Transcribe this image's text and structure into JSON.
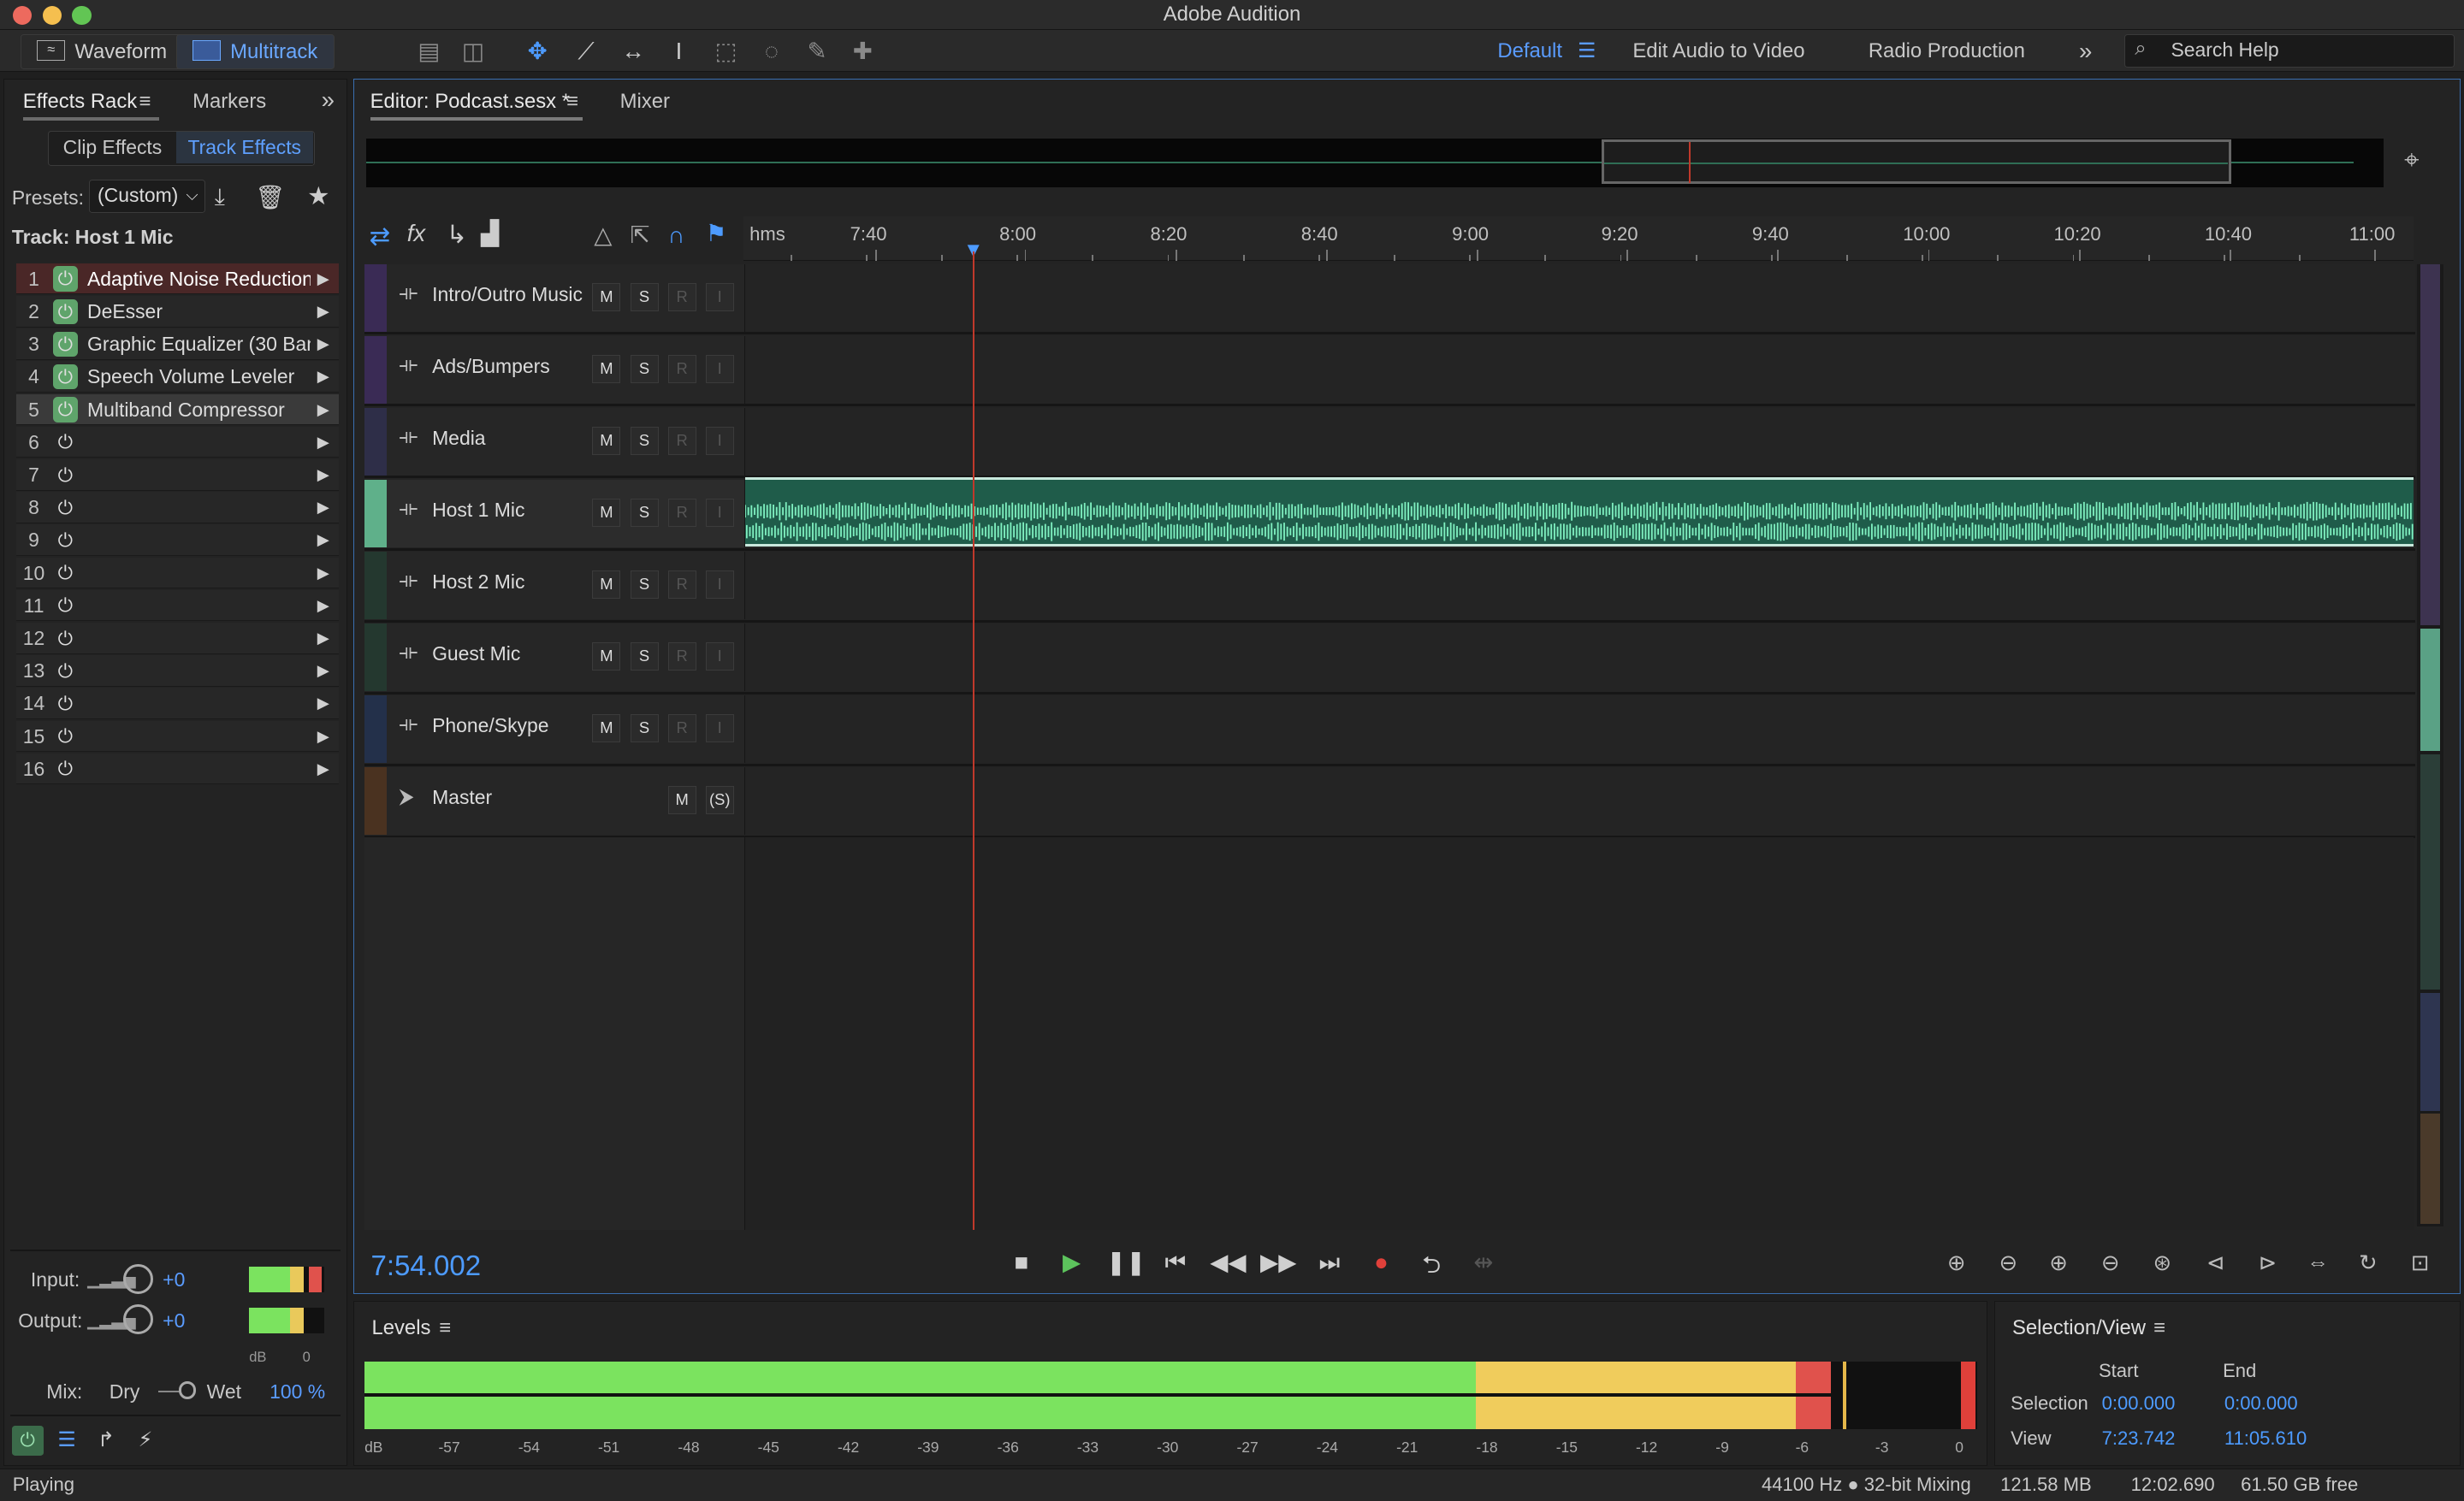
{
  "app": {
    "title": "Adobe Audition"
  },
  "toolbar": {
    "waveform": "Waveform",
    "multitrack": "Multitrack",
    "workspaces": [
      "Default",
      "Edit Audio to Video",
      "Radio Production"
    ],
    "search": "Search Help"
  },
  "left": {
    "tabs": [
      "Effects Rack",
      "Markers"
    ],
    "subtabs": [
      "Clip Effects",
      "Track Effects"
    ],
    "presets_label": "Presets:",
    "preset": "(Custom)",
    "track_label": "Track: Host 1 Mic",
    "effects": [
      {
        "n": "1",
        "name": "Adaptive Noise Reduction",
        "on": true
      },
      {
        "n": "2",
        "name": "DeEsser",
        "on": true
      },
      {
        "n": "3",
        "name": "Graphic Equalizer (30 Ban",
        "on": true
      },
      {
        "n": "4",
        "name": "Speech Volume Leveler",
        "on": true
      },
      {
        "n": "5",
        "name": "Multiband Compressor",
        "on": true
      },
      {
        "n": "6",
        "name": "",
        "on": false
      },
      {
        "n": "7",
        "name": "",
        "on": false
      },
      {
        "n": "8",
        "name": "",
        "on": false
      },
      {
        "n": "9",
        "name": "",
        "on": false
      },
      {
        "n": "10",
        "name": "",
        "on": false
      },
      {
        "n": "11",
        "name": "",
        "on": false
      },
      {
        "n": "12",
        "name": "",
        "on": false
      },
      {
        "n": "13",
        "name": "",
        "on": false
      },
      {
        "n": "14",
        "name": "",
        "on": false
      },
      {
        "n": "15",
        "name": "",
        "on": false
      },
      {
        "n": "16",
        "name": "",
        "on": false
      }
    ],
    "input_label": "Input:",
    "output_label": "Output:",
    "input_val": "+0",
    "output_val": "+0",
    "db_label": "dB",
    "zero": "0",
    "mix_label": "Mix:",
    "dry": "Dry",
    "wet": "Wet",
    "mix_pct": "100 %"
  },
  "editor": {
    "tab": "Editor: Podcast.sesx *",
    "mixer": "Mixer",
    "ruler": [
      "hms",
      "7:40",
      "8:00",
      "8:20",
      "8:40",
      "9:00",
      "9:20",
      "9:40",
      "10:00",
      "10:20",
      "10:40",
      "11:00"
    ],
    "tracks": [
      {
        "name": "Intro/Outro Music",
        "color": "#3a2b55"
      },
      {
        "name": "Ads/Bumpers",
        "color": "#3a2b55"
      },
      {
        "name": "Media",
        "color": "#2e2e48"
      },
      {
        "name": "Host 1 Mic",
        "color": "#5fb08a"
      },
      {
        "name": "Host 2 Mic",
        "color": "#24382f"
      },
      {
        "name": "Guest Mic",
        "color": "#24382f"
      },
      {
        "name": "Phone/Skype",
        "color": "#23304a"
      },
      {
        "name": "Master",
        "color": "#4a3220"
      }
    ],
    "btn": {
      "m": "M",
      "s": "S",
      "r": "R",
      "i": "I",
      "ms": "(S)"
    },
    "time": "7:54.002"
  },
  "levels": {
    "title": "Levels",
    "ticks": [
      "dB",
      "-57",
      "-54",
      "-51",
      "-48",
      "-45",
      "-42",
      "-39",
      "-36",
      "-33",
      "-30",
      "-27",
      "-24",
      "-21",
      "-18",
      "-15",
      "-12",
      "-9",
      "-6",
      "-3",
      "0"
    ]
  },
  "selview": {
    "title": "Selection/View",
    "start": "Start",
    "end": "End",
    "sel_label": "Selection",
    "view_label": "View",
    "sel_start": "0:00.000",
    "sel_end": "0:00.000",
    "view_start": "7:23.742",
    "view_end": "11:05.610"
  },
  "status": {
    "left": "Playing",
    "rate": "44100 Hz ● 32-bit Mixing",
    "mem": "121.58 MB",
    "dur": "12:02.690",
    "free": "61.50 GB free"
  }
}
